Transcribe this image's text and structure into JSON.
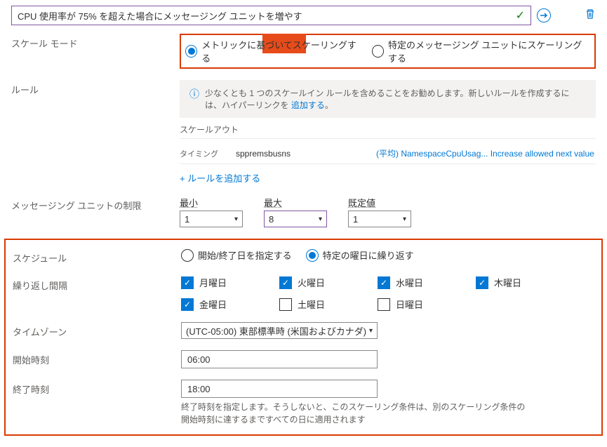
{
  "title": "CPU 使用率が 75% を超えた場合にメッセージング ユニットを増やす",
  "labels": {
    "scaleMode": "スケール モード",
    "rules": "ルール",
    "unitLimits": "メッセージング ユニットの制限",
    "schedule": "スケジュール",
    "repeatInterval": "繰り返し間隔",
    "timezone": "タイムゾーン",
    "startTime": "開始時刻",
    "endTime": "終了時刻"
  },
  "scaleMode": {
    "opt1": "メトリックに基づいてスケーリングする",
    "opt2": "特定のメッセージング ユニットにスケーリングする"
  },
  "rules": {
    "infoText": "少なくとも 1 つのスケールイン ルールを含めることをお勧めします。新しいルールを作成するには、ハイパーリンクを",
    "addLink": "追加する",
    "scaleOut": "スケールアウト",
    "timingLabel": "タイミング",
    "namespace": "sppremsbusns",
    "metricText": "(平均) NamespaceCpuUsag... Increase allowed next value",
    "addRule": "+  ルールを追加する"
  },
  "limits": {
    "minLabel": "最小",
    "maxLabel": "最大",
    "defaultLabel": "既定値",
    "min": "1",
    "max": "8",
    "default": "1"
  },
  "schedule": {
    "opt1": "開始/終了日を指定する",
    "opt2": "特定の曜日に繰り返す"
  },
  "days": {
    "mon": "月曜日",
    "tue": "火曜日",
    "wed": "水曜日",
    "thu": "木曜日",
    "fri": "金曜日",
    "sat": "土曜日",
    "sun": "日曜日"
  },
  "timezone": "(UTC-05:00) 東部標準時 (米国およびカナダ)",
  "startTime": "06:00",
  "endTime": "18:00",
  "endHelper1": "終了時刻を指定します。そうしないと、このスケーリング条件は、別のスケーリング条件の",
  "endHelper2": "開始時刻に達するまですべての日に適用されます"
}
